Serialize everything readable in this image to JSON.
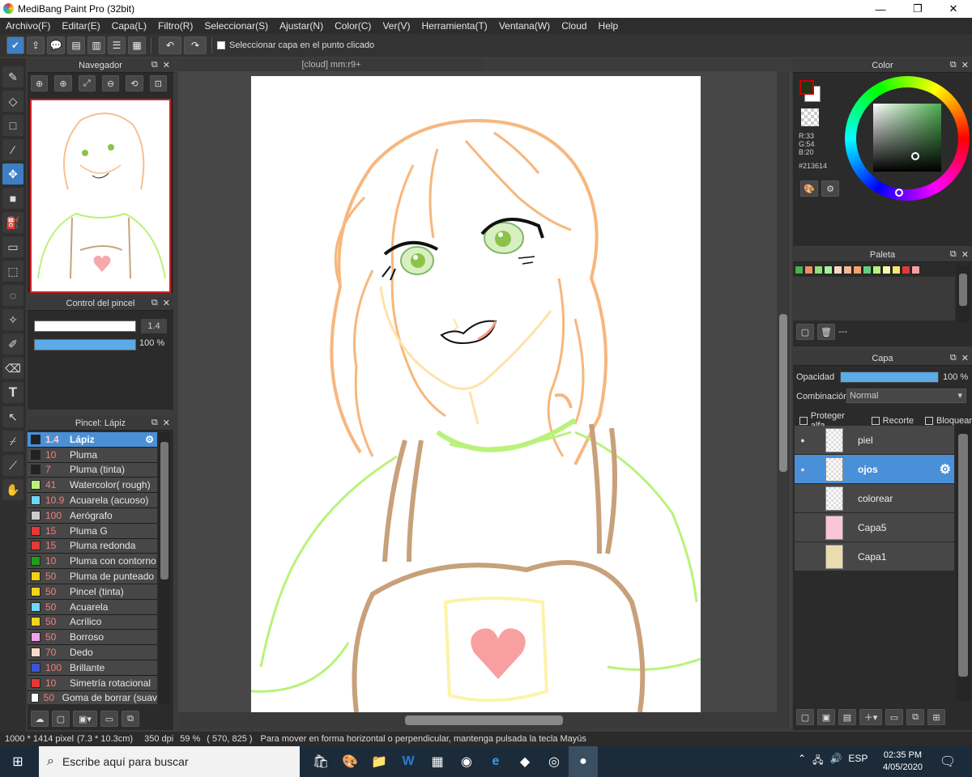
{
  "window": {
    "title": "MediBang Paint Pro (32bit)",
    "min": "—",
    "max": "❐",
    "close": "✕"
  },
  "menu": [
    "Archivo(F)",
    "Editar(E)",
    "Capa(L)",
    "Filtro(R)",
    "Seleccionar(S)",
    "Ajustar(N)",
    "Color(C)",
    "Ver(V)",
    "Herramienta(T)",
    "Ventana(W)",
    "Cloud",
    "Help"
  ],
  "toolbar": {
    "select_layer_label": "Seleccionar capa en el punto clicado"
  },
  "navigator": {
    "title": "Navegador"
  },
  "brush_control": {
    "title": "Control del pincel",
    "size_value": "1.4",
    "opacity_value": "100 %"
  },
  "brush_panel": {
    "title": "Pincel: Lápiz",
    "items": [
      {
        "size": "1.4",
        "name": "Lápiz",
        "color": "#222222",
        "selected": true
      },
      {
        "size": "10",
        "name": "Pluma",
        "color": "#222222"
      },
      {
        "size": "7",
        "name": "Pluma (tinta)",
        "color": "#222222"
      },
      {
        "size": "41",
        "name": "Watercolor( rough)",
        "color": "#b9f27a"
      },
      {
        "size": "10.9",
        "name": "Acuarela (acuoso)",
        "color": "#6fd6f5"
      },
      {
        "size": "100",
        "name": "Aerógrafo",
        "color": "#cccccc"
      },
      {
        "size": "15",
        "name": "Pluma G",
        "color": "#e53935"
      },
      {
        "size": "15",
        "name": "Pluma redonda",
        "color": "#e53935"
      },
      {
        "size": "10",
        "name": "Pluma con contorno",
        "color": "#1e9e1e"
      },
      {
        "size": "50",
        "name": "Pluma de punteado",
        "color": "#f2d21b"
      },
      {
        "size": "50",
        "name": "Pincel (tinta)",
        "color": "#f2d21b"
      },
      {
        "size": "50",
        "name": "Acuarela",
        "color": "#6fd6f5"
      },
      {
        "size": "50",
        "name": "Acrílico",
        "color": "#f2d21b"
      },
      {
        "size": "50",
        "name": "Borroso",
        "color": "#f2a0e8"
      },
      {
        "size": "70",
        "name": "Dedo",
        "color": "#f8ddc6"
      },
      {
        "size": "100",
        "name": "Brillante",
        "color": "#3a55d8"
      },
      {
        "size": "10",
        "name": "Simetría rotacional",
        "color": "#e53935"
      },
      {
        "size": "50",
        "name": "Goma de borrar (suav",
        "color": "#ffffff"
      }
    ]
  },
  "canvas": {
    "tab_title": "[cloud] mm:r9+"
  },
  "color_panel": {
    "title": "Color",
    "r": "R:33",
    "g": "G:54",
    "b": "B:20",
    "hex": "#213614",
    "fg": "#213614",
    "bg": "#ffffff"
  },
  "palette": {
    "title": "Paleta",
    "swatches": [
      "#4caf50",
      "#f08a6a",
      "#8de07a",
      "#a8f0a0",
      "#f7d9c0",
      "#f3b896",
      "#f5a36c",
      "#5fd07a",
      "#b9f27a",
      "#fff6b0",
      "#f8e86b",
      "#e53935",
      "#f5a0a0"
    ],
    "footer_label": "---"
  },
  "layers": {
    "title": "Capa",
    "opacity_label": "Opacidad",
    "opacity_value": "100 %",
    "blend_label": "Combinación",
    "blend_value": "Normal",
    "opt_alpha": "Proteger alfa",
    "opt_clip": "Recorte",
    "opt_lock": "Bloquear",
    "items": [
      {
        "name": "piel",
        "visible": true
      },
      {
        "name": "ojos",
        "visible": true,
        "selected": true
      },
      {
        "name": "colorear",
        "visible": false
      },
      {
        "name": "Capa5",
        "visible": false
      },
      {
        "name": "Capa1",
        "visible": false
      }
    ]
  },
  "status": {
    "size": "1000 * 1414 pixel",
    "cm": "(7.3 * 10.3cm)",
    "dpi": "350 dpi",
    "zoom": "59 %",
    "coords": "( 570, 825 )",
    "hint": "Para mover en forma horizontal o perpendicular, mantenga pulsada la tecla Mayús"
  },
  "taskbar": {
    "search_placeholder": "Escribe aquí para buscar",
    "lang": "ESP",
    "time": "02:35 PM",
    "date": "4/05/2020"
  }
}
